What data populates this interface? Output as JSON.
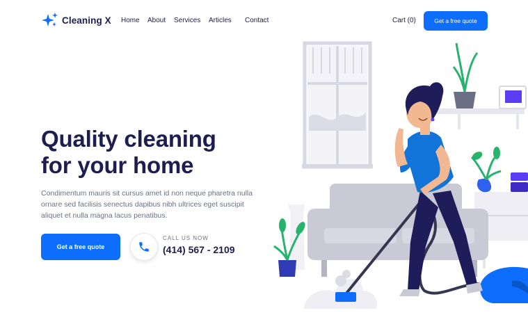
{
  "brand": {
    "name": "Cleaning X",
    "logo_icon": "sparkle-stars-icon",
    "accent": "#0d6efd"
  },
  "nav": {
    "items": [
      "Home",
      "About",
      "Services",
      "Articles",
      "Contact"
    ]
  },
  "header": {
    "cart_label": "Cart (0)",
    "quote_button": "Get a free quote"
  },
  "hero": {
    "headline_line1": "Quality cleaning",
    "headline_line2": "for your home",
    "description": "Condimentum mauris sit cursus amet id non neque pharetra nulla ornare sed facilisis senectus dapibus nibh ultrices eget suscipit aliquet et nulla magna lacus penatibus.",
    "cta_button": "Get a free quote",
    "call_label": "CALL US NOW",
    "phone_number": "(414) 567 - 2109",
    "phone_icon": "phone-icon"
  },
  "illustration": {
    "subject": "woman-vacuuming-illustration"
  },
  "colors": {
    "heading": "#1d1d4f",
    "text": "#6b6f86",
    "button": "#0d6efd"
  }
}
